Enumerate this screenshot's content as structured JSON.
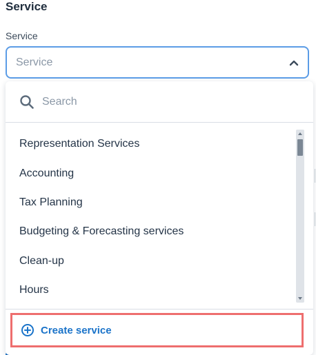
{
  "section": {
    "title": "Service"
  },
  "field": {
    "label": "Service",
    "placeholder": "Service"
  },
  "dropdown": {
    "search_placeholder": "Search",
    "items": [
      {
        "label": "Representation Services"
      },
      {
        "label": "Accounting"
      },
      {
        "label": "Tax Planning"
      },
      {
        "label": "Budgeting & Forecasting services"
      },
      {
        "label": "Clean-up"
      },
      {
        "label": "Hours"
      }
    ],
    "create_label": "Create service"
  },
  "colors": {
    "accent": "#1a73c9",
    "focus_border": "#5b9ce6",
    "highlight_border": "#ee6e6e",
    "text": "#243447",
    "muted": "#8a97a6"
  },
  "icons": {
    "select_toggle": "chevron-up-icon",
    "search": "search-icon",
    "create": "plus-circle-icon"
  }
}
